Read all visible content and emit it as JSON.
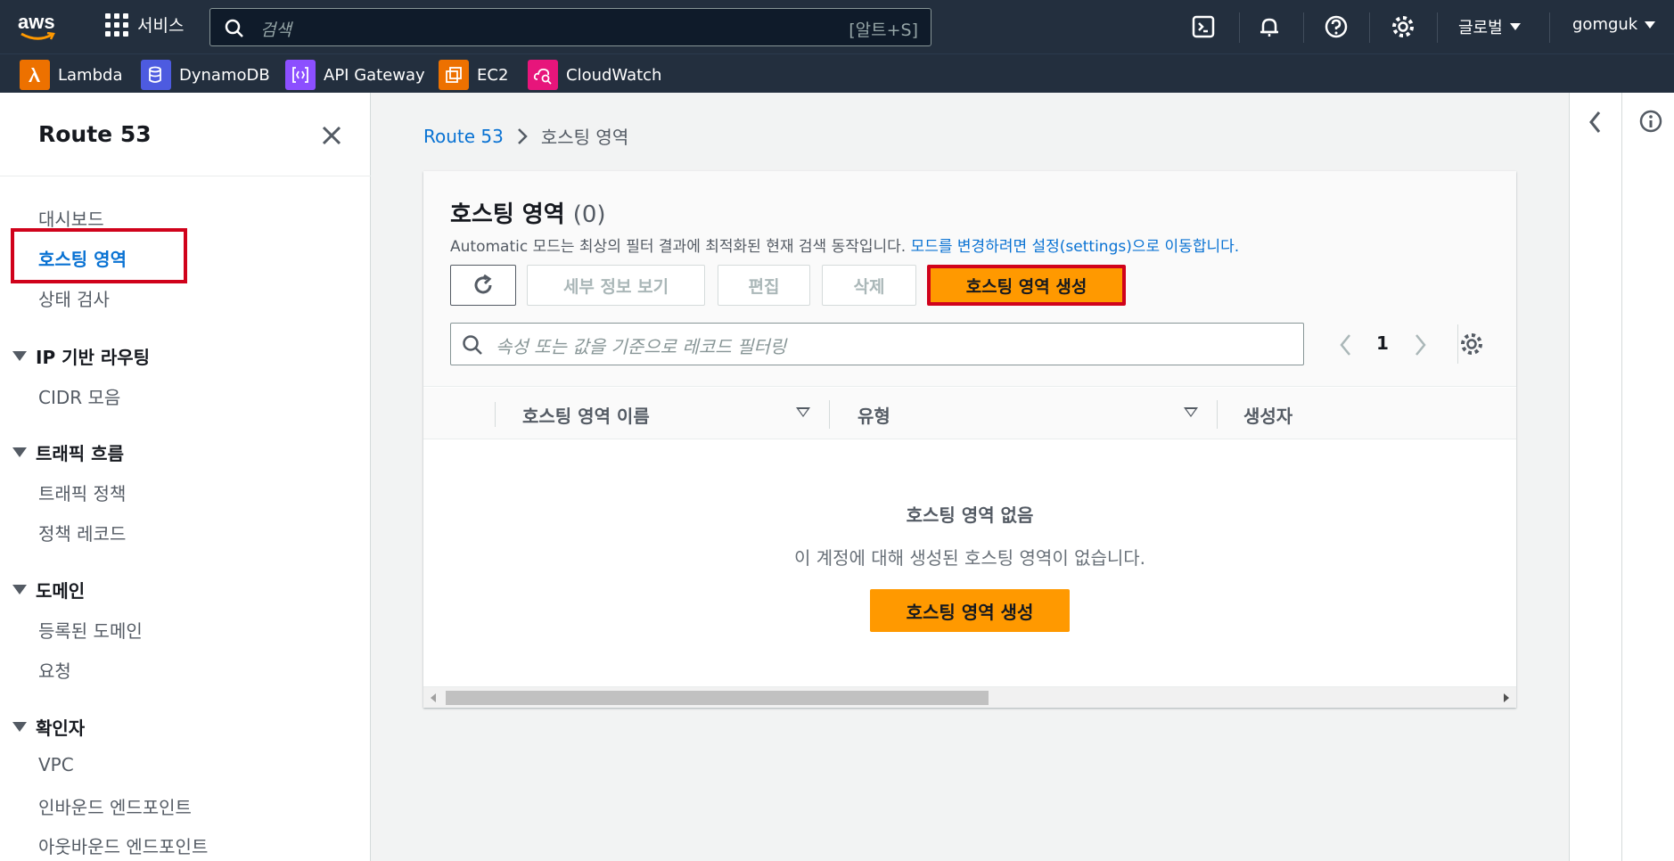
{
  "topnav": {
    "logo": "aws",
    "services_label": "서비스",
    "search_placeholder": "검색",
    "search_shortcut": "[알트+S]",
    "icons": [
      "cloudshell-icon",
      "bell-icon",
      "help-icon",
      "settings-icon"
    ],
    "region_label": "글로벌",
    "user_label": "gomguk"
  },
  "favorites": [
    {
      "label": "Lambda",
      "color": "#ed7100"
    },
    {
      "label": "DynamoDB",
      "color": "#4d5be0"
    },
    {
      "label": "API Gateway",
      "color": "#8c4fff"
    },
    {
      "label": "EC2",
      "color": "#ed7100"
    },
    {
      "label": "CloudWatch",
      "color": "#e7157b"
    }
  ],
  "sidebar": {
    "title": "Route 53",
    "items": {
      "dashboard": "대시보드",
      "hosted_zones": "호스팅 영역",
      "health_checks": "상태 검사",
      "ip_routing": "IP 기반 라우팅",
      "cidr": "CIDR 모음",
      "traffic_flow": "트래픽 흐름",
      "traffic_policy": "트래픽 정책",
      "policy_records": "정책 레코드",
      "domains": "도메인",
      "registered_domains": "등록된 도메인",
      "requests": "요청",
      "resolver": "확인자",
      "vpc": "VPC",
      "inbound": "인바운드 엔드포인트",
      "outbound": "아웃바운드 엔드포인트"
    }
  },
  "breadcrumb": {
    "root": "Route 53",
    "current": "호스팅 영역"
  },
  "panel": {
    "title": "호스팅 영역",
    "count": "(0)",
    "desc_prefix": "Automatic 모드는 최상의 필터 결과에 최적화된 현재 검색 동작입니다.",
    "desc_link": "모드를 변경하려면 설정(settings)으로 이동합니다.",
    "buttons": {
      "details": "세부 정보 보기",
      "edit": "편집",
      "delete": "삭제",
      "create": "호스팅 영역 생성"
    },
    "filter_placeholder": "속성 또는 값을 기준으로 레코드 필터링",
    "page": "1",
    "columns": [
      "호스팅 영역 이름",
      "유형",
      "생성자"
    ],
    "empty_title": "호스팅 영역 없음",
    "empty_desc": "이 계정에 대해 생성된 호스팅 영역이 없습니다.",
    "empty_button": "호스팅 영역 생성"
  }
}
